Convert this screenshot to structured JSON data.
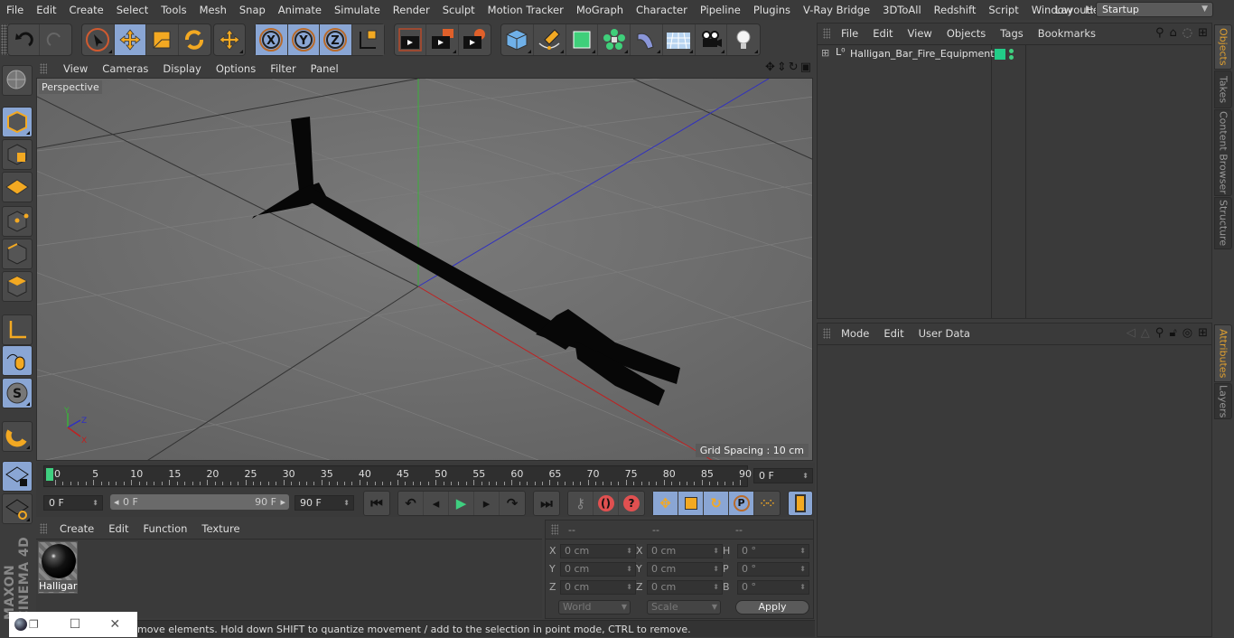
{
  "menubar": {
    "items": [
      "File",
      "Edit",
      "Create",
      "Select",
      "Tools",
      "Mesh",
      "Snap",
      "Animate",
      "Simulate",
      "Render",
      "Sculpt",
      "Motion Tracker",
      "MoGraph",
      "Character",
      "Pipeline",
      "Plugins",
      "V-Ray Bridge",
      "3DToAll",
      "Redshift",
      "Script",
      "Window",
      "Help"
    ],
    "layout_label": "Layout:",
    "layout_value": "Startup"
  },
  "toolbar": {
    "groups": [
      [
        "undo-icon",
        "redo-icon"
      ],
      [
        "live-selection-icon",
        "move-icon",
        "scale-icon",
        "rotate-icon"
      ],
      [
        "recent-tool-icon"
      ],
      [
        "x-axis-lock-icon",
        "y-axis-lock-icon",
        "z-axis-lock-icon",
        "coordinate-system-icon"
      ],
      [
        "render-view-icon",
        "render-to-picture-viewer-icon",
        "render-settings-icon"
      ],
      [
        "cube-icon",
        "pen-spline-icon",
        "subdivision-icon",
        "cloner-icon",
        "deformer-icon",
        "floor-icon",
        "camera-icon",
        "light-icon"
      ]
    ]
  },
  "left_toolbar": {
    "items": [
      "make-editable-icon",
      "model-mode-icon",
      "texture-mode-icon",
      "workplane-icon",
      "points-mode-icon",
      "edges-mode-icon",
      "polygons-mode-icon",
      "axis-mode-icon",
      "tweak-mode-icon",
      "solo-icon",
      "snap-icon",
      "workplane-lock-icon",
      "workplane-align-icon"
    ]
  },
  "viewport": {
    "menu": [
      "View",
      "Cameras",
      "Display",
      "Options",
      "Filter",
      "Panel"
    ],
    "label": "Perspective",
    "grid_spacing": "Grid Spacing : 10 cm",
    "axis_labels": {
      "x": "X",
      "y": "Y",
      "z": "Z"
    },
    "nav_icons": [
      "move-view-icon",
      "zoom-view-icon",
      "rotate-view-icon",
      "maximize-view-icon"
    ]
  },
  "timeline": {
    "ticks": [
      "0",
      "5",
      "10",
      "15",
      "20",
      "25",
      "30",
      "35",
      "40",
      "45",
      "50",
      "55",
      "60",
      "65",
      "70",
      "75",
      "80",
      "85",
      "90"
    ],
    "current_frame": "0 F",
    "start_field": "0 F",
    "range_start": "0 F",
    "range_end": "90 F",
    "end_field": "90 F"
  },
  "materials": {
    "menu": [
      "Create",
      "Edit",
      "Function",
      "Texture"
    ],
    "items": [
      {
        "name": "Halligar"
      }
    ]
  },
  "coordinates": {
    "headers": [
      "--",
      "--",
      "--"
    ],
    "rows": [
      {
        "l1": "X",
        "v1": "0 cm",
        "l2": "X",
        "v2": "0 cm",
        "l3": "H",
        "v3": "0 °"
      },
      {
        "l1": "Y",
        "v1": "0 cm",
        "l2": "Y",
        "v2": "0 cm",
        "l3": "P",
        "v3": "0 °"
      },
      {
        "l1": "Z",
        "v1": "0 cm",
        "l2": "Z",
        "v2": "0 cm",
        "l3": "B",
        "v3": "0 °"
      }
    ],
    "mode": "World",
    "transform": "Scale",
    "apply": "Apply"
  },
  "objects": {
    "menu": [
      "File",
      "Edit",
      "View",
      "Objects",
      "Tags",
      "Bookmarks"
    ],
    "items": [
      {
        "name": "Halligan_Bar_Fire_Equipment",
        "color": "#22cc88"
      }
    ]
  },
  "attributes": {
    "menu": [
      "Mode",
      "Edit",
      "User Data"
    ]
  },
  "right_tabs": {
    "top": [
      "Objects",
      "Takes",
      "Content Browser",
      "Structure"
    ],
    "bottom": [
      "Attributes",
      "Layers"
    ]
  },
  "branding": "MAXON CINEMA 4D",
  "status": "move elements. Hold down SHIFT to quantize movement / add to the selection in point mode, CTRL to remove."
}
